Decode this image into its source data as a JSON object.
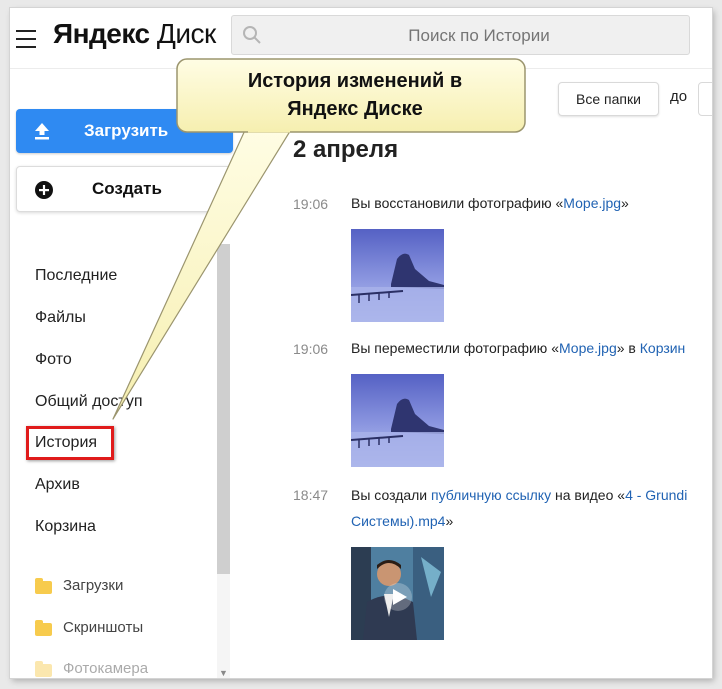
{
  "header": {
    "logo_brand": "Яндекс",
    "logo_product": "Диск",
    "search_placeholder": "Поиск по Истории"
  },
  "sidebar": {
    "upload_label": "Загрузить",
    "create_label": "Создать",
    "nav": [
      "Последние",
      "Файлы",
      "Фото",
      "Общий доступ",
      "История",
      "Архив",
      "Корзина"
    ],
    "active_item": "История",
    "folders": [
      "Загрузки",
      "Скриншоты",
      "Фотокамера"
    ]
  },
  "toolbar": {
    "folders_button": "Все папки",
    "do_label": "до"
  },
  "history": {
    "date": "2 апреля",
    "events": [
      {
        "time": "19:06",
        "pre": "Вы восстановили фотографию «",
        "link": "Море.jpg",
        "post": "»"
      },
      {
        "time": "19:06",
        "pre": "Вы переместили фотографию «",
        "link": "Море.jpg",
        "post": "» в ",
        "link2": "Корзин"
      },
      {
        "time": "18:47",
        "pre": "Вы создали ",
        "link": "публичную ссылку",
        "mid": " на видео «",
        "link2": "4 - Grundi",
        "line2_link": "Системы).mp4",
        "line2_post": "»"
      }
    ]
  },
  "callout": {
    "line1": "История изменений в",
    "line2": "Яндекс Диске"
  },
  "colors": {
    "accent_blue": "#2f8af2",
    "link_blue": "#2163b3",
    "highlight_red": "#e01b1b",
    "callout_fill": "#fbf7c6"
  }
}
